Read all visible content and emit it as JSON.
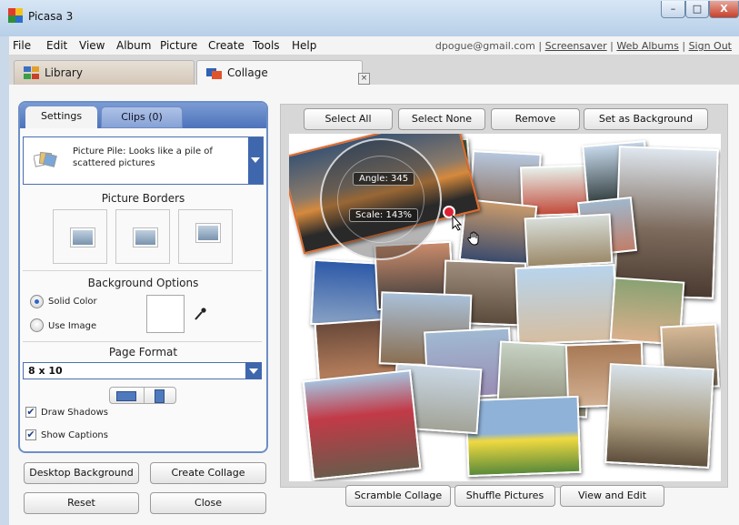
{
  "window": {
    "title": "Picasa 3",
    "controls": {
      "minimize": "–",
      "maximize": "□",
      "close": "X"
    },
    "icon": "picasa-logo-icon"
  },
  "menu": {
    "items": [
      "File",
      "Edit",
      "View",
      "Album",
      "Picture",
      "Create",
      "Tools",
      "Help"
    ],
    "account_email": "dpogue@gmail.com",
    "links": [
      "Screensaver",
      "Web Albums",
      "Sign Out"
    ],
    "separator": "|"
  },
  "tabs": [
    {
      "label": "Library",
      "icon": "library-grid-icon"
    },
    {
      "label": "Collage",
      "icon": "collage-icon",
      "close": "×"
    }
  ],
  "panel": {
    "tabs": [
      "Settings",
      "Clips (0)"
    ],
    "style": {
      "text": "Picture Pile:  Looks like a pile of scattered pictures",
      "icon": "picture-pile-icon"
    },
    "picture_borders_title": "Picture Borders",
    "background_title": "Background Options",
    "background_options": [
      {
        "label": "Solid Color",
        "selected": true
      },
      {
        "label": "Use Image",
        "selected": false
      }
    ],
    "background_color": "#ffffff",
    "page_format_title": "Page Format",
    "page_format_value": "8 x 10",
    "checkboxes": [
      {
        "label": "Draw Shadows",
        "checked": true,
        "mark": "✔"
      },
      {
        "label": "Show Captions",
        "checked": true,
        "mark": "✔"
      }
    ],
    "buttons": [
      "Desktop Background",
      "Create Collage",
      "Reset",
      "Close"
    ]
  },
  "collage": {
    "top_buttons": [
      "Select All",
      "Select None",
      "Remove",
      "Set as Background"
    ],
    "bottom_buttons": [
      "Scramble Collage",
      "Shuffle Pictures",
      "View and Edit"
    ],
    "angle_label": "Angle: 345",
    "scale_label": "Scale: 143%"
  },
  "colors": {
    "accent_blue": "#4d73bb",
    "title_bar": "#c9dbee",
    "close_red": "#c8412b"
  }
}
